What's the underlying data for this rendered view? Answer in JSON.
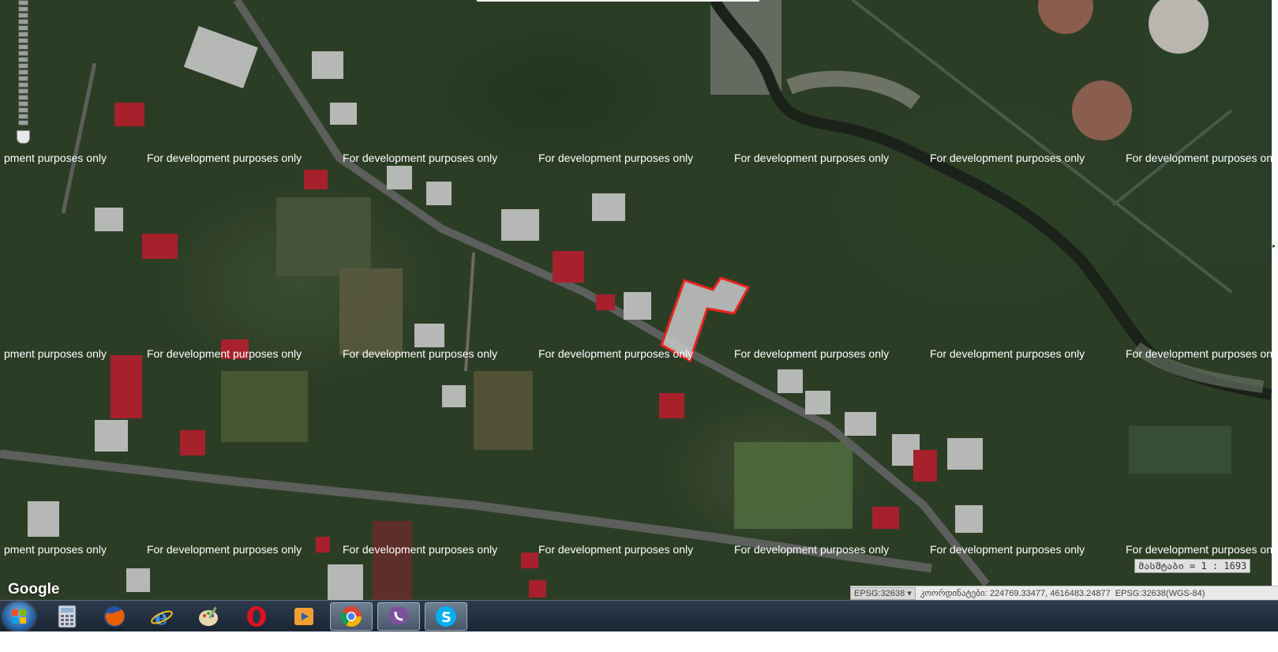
{
  "map": {
    "watermark_text": "For development purposes only",
    "watermark_text_clipped": "pment purposes only",
    "provider_logo": "Google",
    "scale_label": "მასშტაბი = 1 : 1693",
    "parcel_outline_color": "#e8231e",
    "parcel_fill_color": "#c8c8c8"
  },
  "status_bar": {
    "crs_selector": "EPSG:32638 ▾",
    "coordinates_label": "კოორდინატები: 224769.33477, 4616483.24877",
    "crs_info": "EPSG:32638(WGS-84)"
  },
  "taskbar": {
    "start_icon": "windows-start-icon",
    "items": [
      {
        "name": "calculator-icon"
      },
      {
        "name": "firefox-icon"
      },
      {
        "name": "internet-explorer-icon"
      },
      {
        "name": "paint-icon"
      },
      {
        "name": "opera-icon"
      },
      {
        "name": "media-player-icon"
      },
      {
        "name": "chrome-icon"
      },
      {
        "name": "viber-icon"
      },
      {
        "name": "skype-icon"
      }
    ]
  }
}
